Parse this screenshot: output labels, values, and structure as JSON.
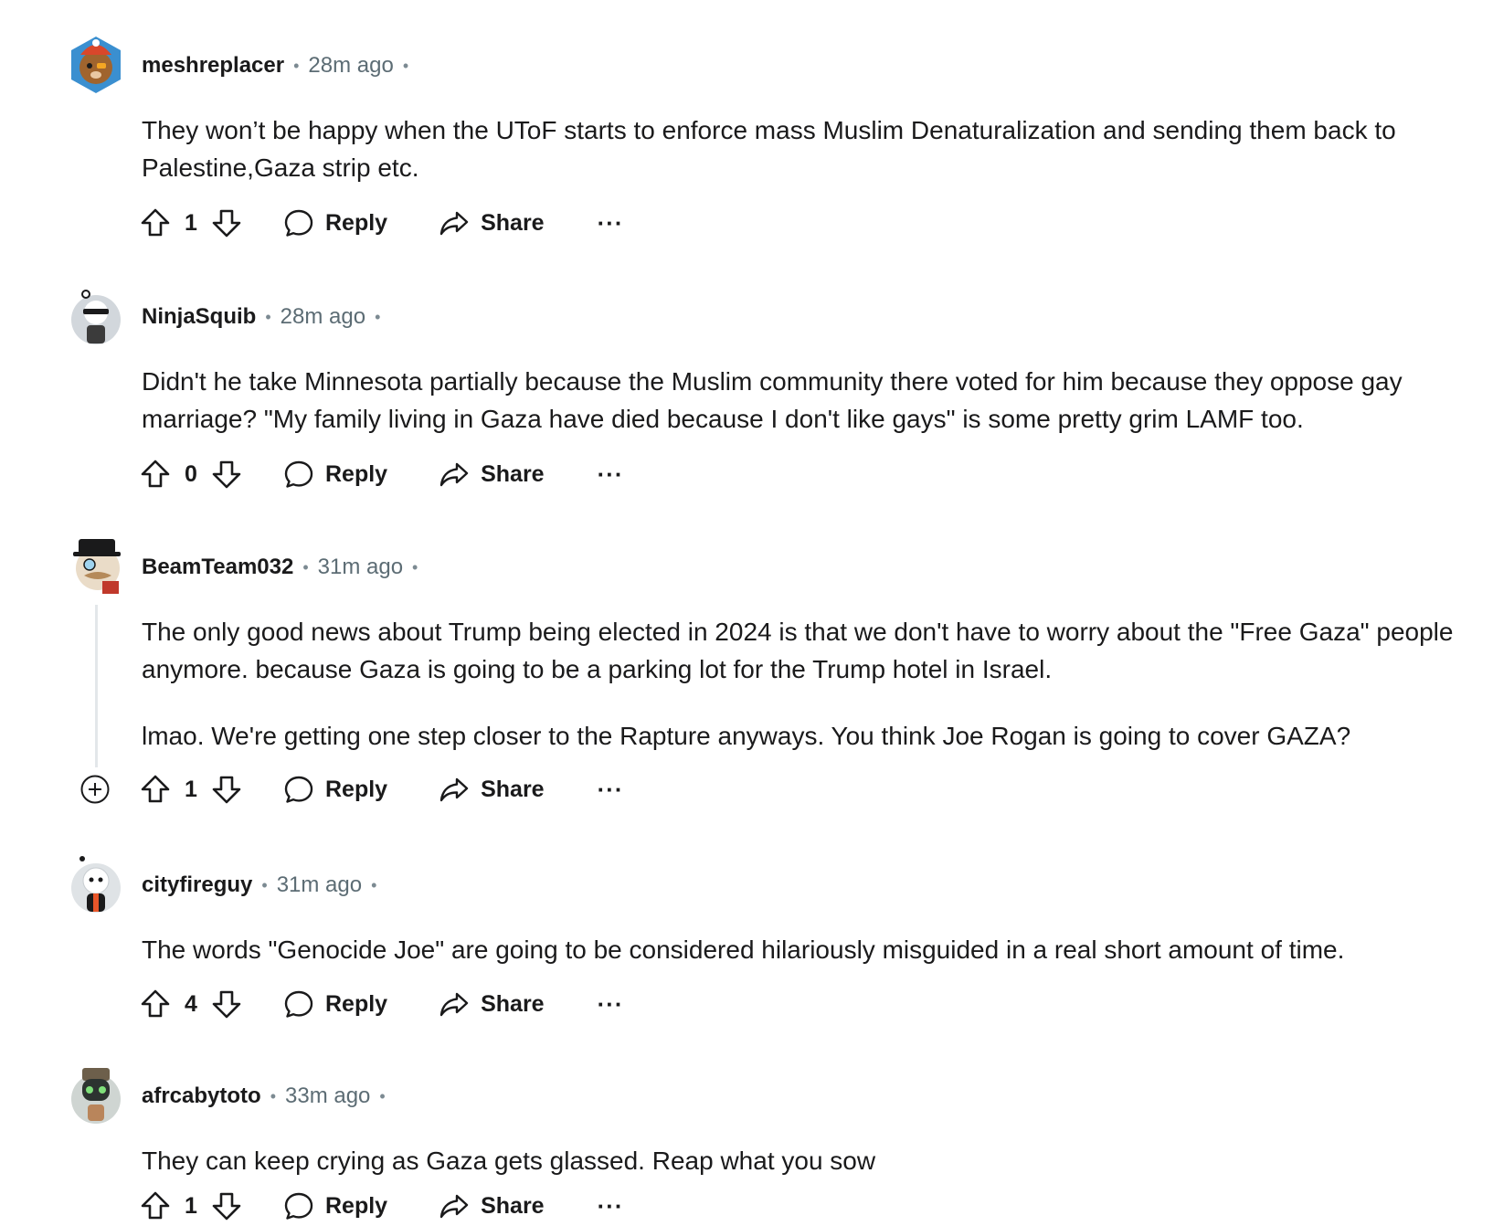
{
  "comments": [
    {
      "username": "meshreplacer",
      "time": "28m ago",
      "body": [
        "They won’t be happy when the UToF starts to enforce mass Muslim Denaturalization and sending them back to Palestine,Gaza strip etc."
      ],
      "votes": "1",
      "avatar_color": "#3a8fd0"
    },
    {
      "username": "NinjaSquib",
      "time": "28m ago",
      "body": [
        "Didn't he take Minnesota partially because the Muslim community there voted for him because they oppose gay marriage? \"My family living in Gaza have died because I don't like gays\" is some pretty grim LAMF too."
      ],
      "votes": "0",
      "avatar_color": "#c9ced3"
    },
    {
      "username": "BeamTeam032",
      "time": "31m ago",
      "body": [
        "The only good news about Trump being elected in 2024 is that we don't have to worry about the \"Free Gaza\" people anymore. because Gaza is going to be a parking lot for the Trump hotel in Israel.",
        "lmao. We're getting one step closer to the Rapture anyways. You think Joe Rogan is going to cover GAZA?"
      ],
      "votes": "1",
      "avatar_color": "#b58a5a"
    },
    {
      "username": "cityfireguy",
      "time": "31m ago",
      "body": [
        "The words \"Genocide Joe\" are going to be considered hilariously misguided in a real short amount of time."
      ],
      "votes": "4",
      "avatar_color": "#d7dadd"
    },
    {
      "username": "afrcabytoto",
      "time": "33m ago",
      "body": [
        "They can keep crying as Gaza gets glassed. Reap what you sow"
      ],
      "votes": "1",
      "avatar_color": "#7a8a84"
    }
  ],
  "labels": {
    "reply": "Reply",
    "share": "Share",
    "more": "···"
  }
}
